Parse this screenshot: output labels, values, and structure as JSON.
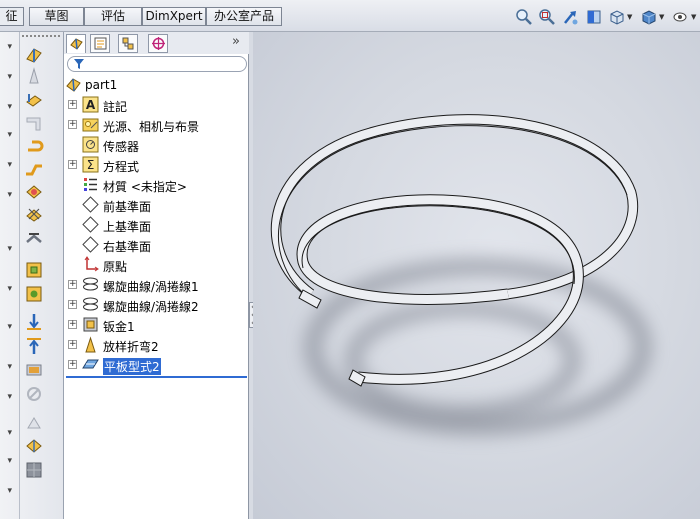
{
  "command_tabs": [
    {
      "label": "征"
    },
    {
      "label": "草图"
    },
    {
      "label": "评估"
    },
    {
      "label": "DimXpert"
    },
    {
      "label": "办公室产品"
    }
  ],
  "view_toolbar": {
    "icons": [
      "zoom-to-fit-icon",
      "zoom-area-icon",
      "previous-view-icon",
      "section-view-icon",
      "view-orientation-icon",
      "display-style-icon",
      "hide-show-items-icon"
    ]
  },
  "left_toolbar": {
    "icons": [
      "base-flange-icon",
      "lofted-bend-icon",
      "edge-flange-icon",
      "miter-flange-icon",
      "hem-icon",
      "jog-icon",
      "sketched-bend-icon",
      "cross-break-icon",
      "corner-icon",
      "closed-corner-icon",
      "welded-corner-icon",
      "break-corner-icon",
      "unfold-icon",
      "fold-icon",
      "flatten-icon",
      "no-bends-icon",
      "rip-icon",
      "insert-bends-icon",
      "extruded-cut-icon",
      "simple-hole-icon"
    ]
  },
  "feature_manager": {
    "tabs": [
      "feature-manager-tab",
      "property-manager-tab",
      "configuration-manager-tab",
      "dimxpert-manager-tab"
    ],
    "expand_glyph": "»",
    "root": "part1",
    "items": [
      {
        "label": "註記",
        "icon": "annotations-icon",
        "expandable": true
      },
      {
        "label": "光源、相机与布景",
        "icon": "lights-cameras-icon",
        "expandable": true
      },
      {
        "label": "传感器",
        "icon": "sensors-icon",
        "expandable": false
      },
      {
        "label": "方程式",
        "icon": "equations-icon",
        "expandable": true
      },
      {
        "label": "材質 <未指定>",
        "icon": "material-icon",
        "expandable": false
      },
      {
        "label": "前基準面",
        "icon": "plane-icon",
        "expandable": false
      },
      {
        "label": "上基準面",
        "icon": "plane-icon",
        "expandable": false
      },
      {
        "label": "右基準面",
        "icon": "plane-icon",
        "expandable": false
      },
      {
        "label": "原點",
        "icon": "origin-icon",
        "expandable": false
      },
      {
        "label": "螺旋曲線/渦捲線1",
        "icon": "helix-icon",
        "expandable": true
      },
      {
        "label": "螺旋曲線/渦捲線2",
        "icon": "helix-icon",
        "expandable": true
      },
      {
        "label": "钣金1",
        "icon": "sheet-metal-icon",
        "expandable": true
      },
      {
        "label": "放样折弯2",
        "icon": "lofted-bend-icon",
        "expandable": true
      },
      {
        "label": "平板型式2",
        "icon": "flat-pattern-icon",
        "expandable": true,
        "selected": true
      }
    ]
  },
  "colors": {
    "selection": "#2f6bd3",
    "viewport_bg": "#d5d9e1",
    "model_face": "#ecedf0",
    "model_edge": "#1a1a1a"
  }
}
